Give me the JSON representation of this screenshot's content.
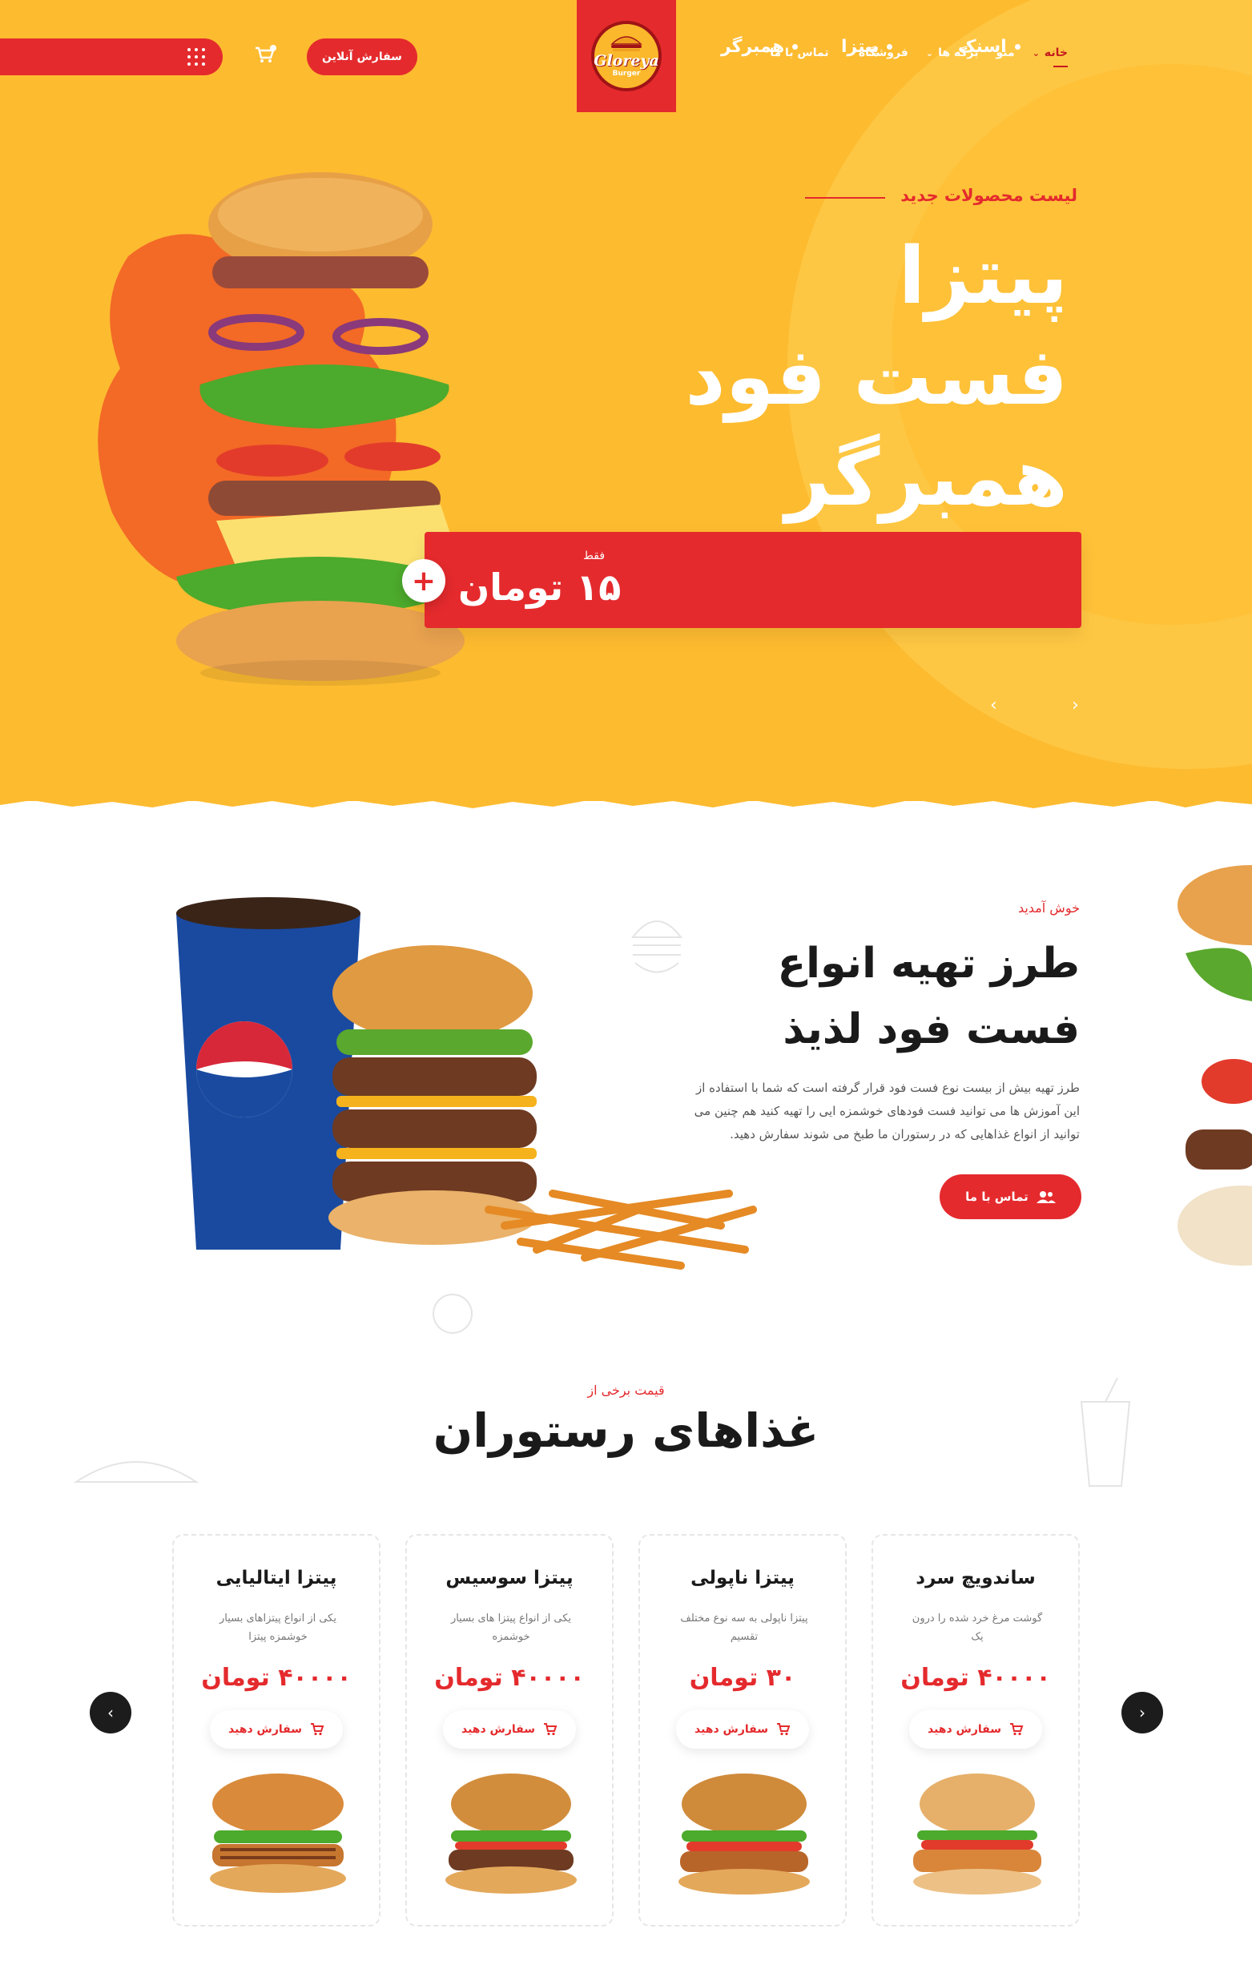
{
  "header": {
    "nav": [
      {
        "label": "خانه",
        "active": true,
        "has_dropdown": true
      },
      {
        "label": "منو",
        "active": false,
        "has_dropdown": false
      },
      {
        "label": "برگه ها",
        "active": false,
        "has_dropdown": true
      },
      {
        "label": "فروشگاه",
        "active": false,
        "has_dropdown": true
      },
      {
        "label": "تماس با ما",
        "active": false,
        "has_dropdown": false
      }
    ],
    "order_online_label": "سفارش آنلاین",
    "logo_text": "Gloreya",
    "logo_sub": "Burger"
  },
  "hero": {
    "tag": "لیست محصولات جدید",
    "title_lines": [
      "پیتزا",
      "فست فود",
      "همبرگر"
    ],
    "bar_items": [
      "اسنک",
      "پیتزا",
      "همبرگر"
    ],
    "price_prefix": "فقط",
    "price": "۱۵ تومان",
    "plus_label": "+",
    "prev_arrow": "‹",
    "next_arrow": "›"
  },
  "about": {
    "kicker": "خوش آمدید",
    "title_line1": "طرز تهیه انواع",
    "title_line2": "فست فود لذیذ",
    "text": "طرز تهیه بیش از بیست نوع فست فود قرار گرفته است که شما با استفاده از این آموزش ها می توانید فست فودهای خوشمزه ایی را تهیه کنید هم چنین می توانید از انواع غذاهایی که در رستوران ما طبخ می شوند سفارش دهید.",
    "button_label": "تماس با ما"
  },
  "menu": {
    "kicker": "قیمت برخی از",
    "title": "غذاهای رستوران",
    "order_label": "سفارش دهید",
    "items": [
      {
        "name": "پیتزا ایتالیایی",
        "desc": "یکی از انواع پیتزاهای بسیار خوشمزه پیتزا",
        "price": "۴۰۰۰۰ تومان"
      },
      {
        "name": "پیتزا سوسیس",
        "desc": "یکی از انواع پیتزا های بسیار خوشمزه",
        "price": "۴۰۰۰۰ تومان"
      },
      {
        "name": "پیتزا ناپولی",
        "desc": "پیتزا ناپولی به سه نوع مختلف تقسیم",
        "price": "۳۰ تومان"
      },
      {
        "name": "ساندویچ سرد",
        "desc": "گوشت مرغ خرد شده را درون یک",
        "price": "۴۰۰۰۰ تومان"
      }
    ],
    "prev_arrow": "‹",
    "next_arrow": "›"
  },
  "colors": {
    "brand_red": "#e42a2d",
    "hero_yellow": "#fdbb30",
    "dark": "#1a1a1a"
  }
}
